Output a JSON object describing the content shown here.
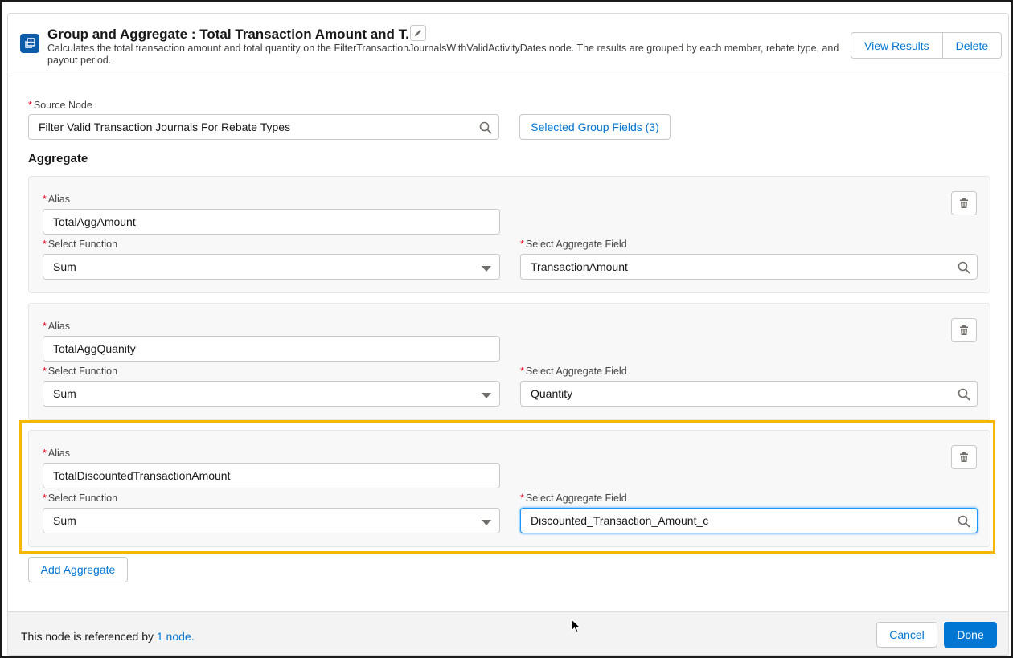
{
  "header": {
    "title": "Group and Aggregate :  Total Transaction Amount and T...",
    "description": "Calculates the total transaction amount and total quantity on the FilterTransactionJournalsWithValidActivityDates node. The results are grouped by each member, rebate type, and payout period.",
    "view_results_label": "View Results",
    "delete_label": "Delete",
    "node_icon": "group-aggregate-icon",
    "edit_icon": "pencil-icon"
  },
  "source_node": {
    "label": "Source Node",
    "required_marker": "*",
    "value": "Filter Valid Transaction Journals For Rebate Types",
    "search_icon": "search-icon"
  },
  "group_fields_button": "Selected Group Fields (3)",
  "aggregate_section_title": "Aggregate",
  "aggregates": [
    {
      "alias_label": "Alias",
      "alias_value": "TotalAggAmount",
      "function_label": "Select Function",
      "function_value": "Sum",
      "field_label": "Select Aggregate Field",
      "field_value": "TransactionAmount",
      "focused": false
    },
    {
      "alias_label": "Alias",
      "alias_value": "TotalAggQuanity",
      "function_label": "Select Function",
      "function_value": "Sum",
      "field_label": "Select Aggregate Field",
      "field_value": "Quantity",
      "focused": false
    },
    {
      "alias_label": "Alias",
      "alias_value": "TotalDiscountedTransactionAmount",
      "function_label": "Select Function",
      "function_value": "Sum",
      "field_label": "Select Aggregate Field",
      "field_value": "Discounted_Transaction_Amount_c",
      "focused": true
    }
  ],
  "add_aggregate_label": "Add Aggregate",
  "footer": {
    "reference_text": "This node is referenced by ",
    "reference_link": "1 node.",
    "cancel_label": "Cancel",
    "done_label": "Done"
  },
  "colors": {
    "brand": "#0176d3",
    "required": "#ea001e",
    "highlight": "#f5b800",
    "node_icon_bg": "#0b5cab"
  }
}
